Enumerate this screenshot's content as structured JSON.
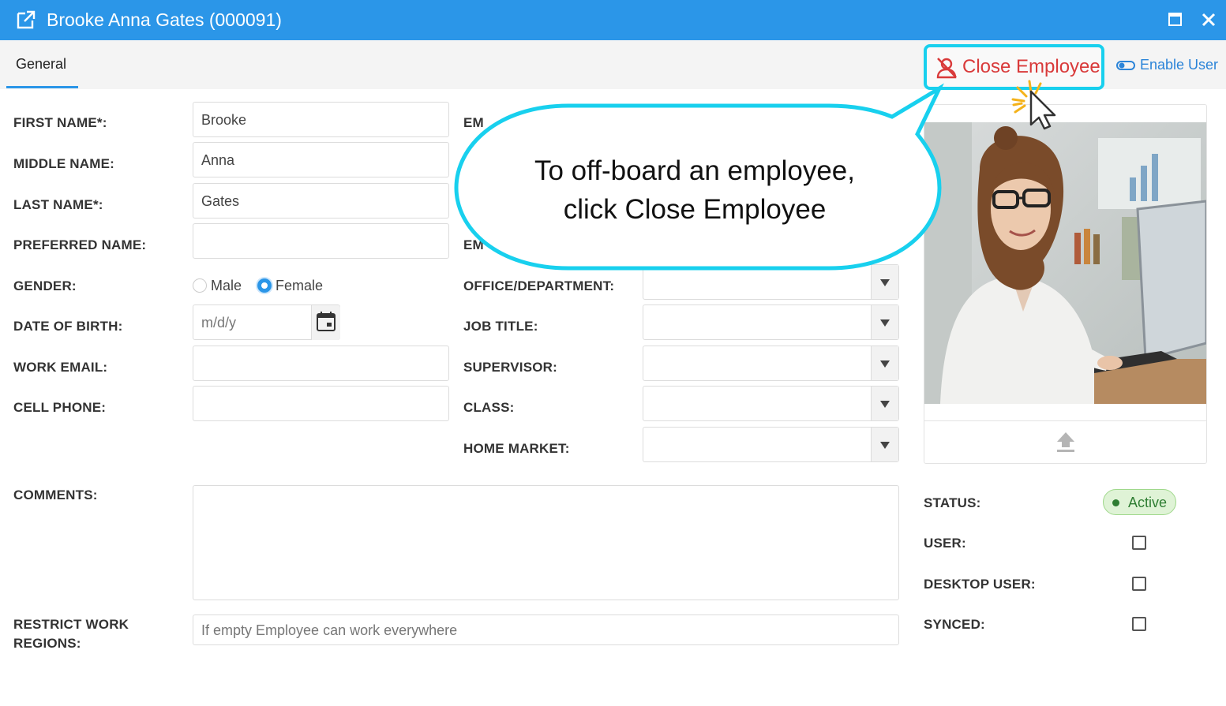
{
  "window": {
    "title": "Brooke Anna Gates (000091)",
    "popout_icon": "popout-icon",
    "maximize_icon": "maximize-icon",
    "close_icon": "close-icon"
  },
  "tabs": [
    {
      "label": "General",
      "active": true
    }
  ],
  "toolbar": {
    "close_employee_label": "Close Employee",
    "close_employee_icon": "person-off-icon",
    "enable_user_label": "Enable User",
    "enable_user_icon": "toggle-icon"
  },
  "colors": {
    "accent": "#2b96e8",
    "close_employee": "#d93a3a",
    "callout_border": "#18d0ee",
    "active_green": "#2e7d32"
  },
  "form": {
    "first_name": {
      "label": "FIRST NAME*:",
      "value": "Brooke"
    },
    "middle_name": {
      "label": "MIDDLE NAME:",
      "value": "Anna"
    },
    "last_name": {
      "label": "LAST NAME*:",
      "value": "Gates"
    },
    "preferred_name": {
      "label": "PREFERRED NAME:",
      "value": ""
    },
    "gender": {
      "label": "GENDER:",
      "options": [
        "Male",
        "Female"
      ],
      "selected": "Female"
    },
    "date_of_birth": {
      "label": "DATE OF BIRTH:",
      "placeholder": "m/d/y"
    },
    "work_email": {
      "label": "WORK EMAIL:",
      "value": ""
    },
    "cell_phone": {
      "label": "CELL PHONE:",
      "value": ""
    },
    "emp_label_1": "EM",
    "emp_label_2": "EM",
    "office_department": {
      "label": "OFFICE/DEPARTMENT:",
      "value": ""
    },
    "job_title": {
      "label": "JOB TITLE:",
      "value": ""
    },
    "supervisor": {
      "label": "SUPERVISOR:",
      "value": ""
    },
    "class": {
      "label": "CLASS:",
      "value": ""
    },
    "home_market": {
      "label": "HOME MARKET:",
      "value": ""
    },
    "comments": {
      "label": "COMMENTS:",
      "value": ""
    },
    "restrict_work_regions": {
      "label_line1": "RESTRICT WORK",
      "label_line2": "REGIONS:",
      "placeholder": "If empty Employee can work everywhere"
    }
  },
  "side": {
    "upload_icon": "upload-icon",
    "status": {
      "label": "STATUS:",
      "value": "Active"
    },
    "user": {
      "label": "USER:",
      "checked": false
    },
    "desktop_user": {
      "label": "DESKTOP USER:",
      "checked": false
    },
    "synced": {
      "label": "SYNCED:",
      "checked": false
    }
  },
  "callout": {
    "line1": "To off-board an employee,",
    "line2": "click Close Employee"
  }
}
